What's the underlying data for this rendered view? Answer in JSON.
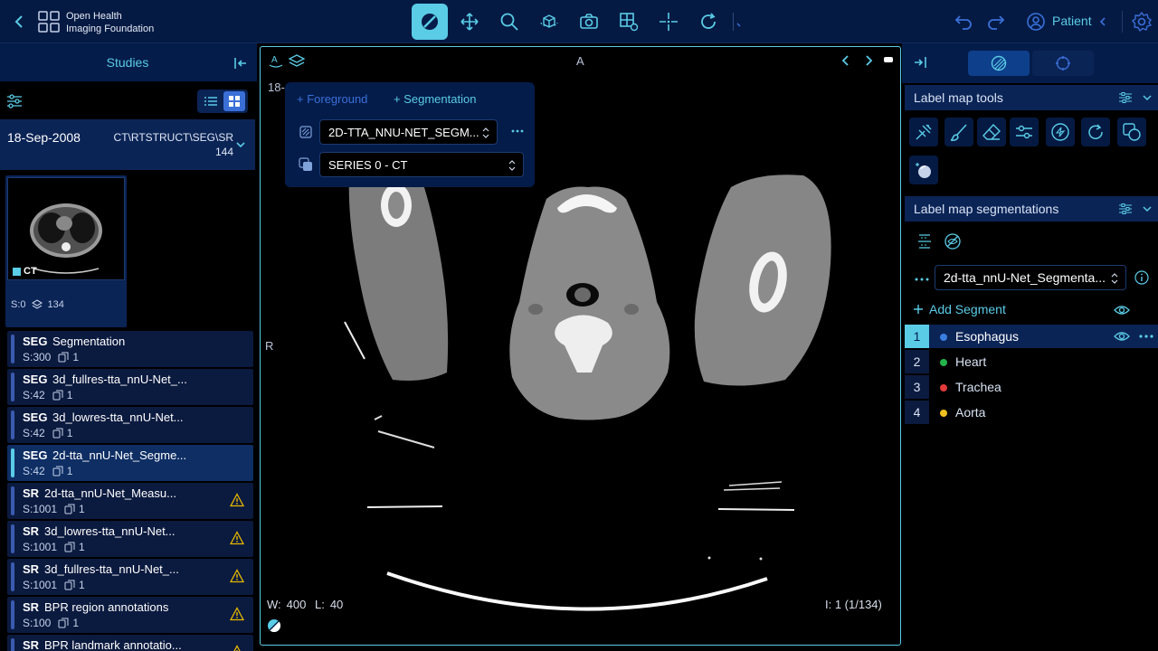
{
  "app": {
    "brand_line1": "Open Health",
    "brand_line2": "Imaging Foundation",
    "patient_label": "Patient"
  },
  "toolbar": {
    "tools": [
      "segmentation-tool-icon",
      "pan-icon",
      "zoom-icon",
      "3d-rotate-icon",
      "capture-icon",
      "layout-icon",
      "crosshairs-icon",
      "reset-icon"
    ]
  },
  "left_panel": {
    "title": "Studies",
    "study": {
      "date": "18-Sep-2008",
      "modalities": "CT\\RTSTRUCT\\SEG\\SR",
      "instances": "144"
    },
    "thumbnail": {
      "modality": "CT",
      "series_number": "S:0",
      "instance_count": "134"
    },
    "series": [
      {
        "modality": "SEG",
        "description": "Segmentation",
        "number": "S:300",
        "count": "1",
        "warning": false,
        "selected": false
      },
      {
        "modality": "SEG",
        "description": "3d_fullres-tta_nnU-Net_...",
        "number": "S:42",
        "count": "1",
        "warning": false,
        "selected": false
      },
      {
        "modality": "SEG",
        "description": "3d_lowres-tta_nnU-Net...",
        "number": "S:42",
        "count": "1",
        "warning": false,
        "selected": false
      },
      {
        "modality": "SEG",
        "description": "2d-tta_nnU-Net_Segme...",
        "number": "S:42",
        "count": "1",
        "warning": false,
        "selected": true
      },
      {
        "modality": "SR",
        "description": "2d-tta_nnU-Net_Measu...",
        "number": "S:1001",
        "count": "1",
        "warning": true,
        "selected": false
      },
      {
        "modality": "SR",
        "description": "3d_lowres-tta_nnU-Net...",
        "number": "S:1001",
        "count": "1",
        "warning": true,
        "selected": false
      },
      {
        "modality": "SR",
        "description": "3d_fullres-tta_nnU-Net_...",
        "number": "S:1001",
        "count": "1",
        "warning": true,
        "selected": false
      },
      {
        "modality": "SR",
        "description": "BPR region annotations",
        "number": "S:100",
        "count": "1",
        "warning": true,
        "selected": false
      },
      {
        "modality": "SR",
        "description": "BPR landmark annotatio...",
        "number": "",
        "count": "",
        "warning": true,
        "selected": false
      }
    ]
  },
  "viewport": {
    "orientation_top": "A",
    "orientation_left": "R",
    "date_fragment": "18-",
    "window_label": "W:",
    "window_value": "400",
    "level_label": "L:",
    "level_value": "40",
    "image_index": "I: 1 (1/134)",
    "overlay": {
      "foreground_label": "+ Foreground",
      "segmentation_label": "+ Segmentation",
      "segmentation_select": "2D-TTA_NNU-NET_SEGM...",
      "series_select": "SERIES 0 - CT"
    }
  },
  "right_panel": {
    "tools_section": "Label map tools",
    "segmentations_section": "Label map segmentations",
    "segmentation_select": "2d-tta_nnU-Net_Segmenta...",
    "add_segment": "Add Segment",
    "segments": [
      {
        "index": "1",
        "label": "Esophagus",
        "color": "#3a7fe0",
        "active": true
      },
      {
        "index": "2",
        "label": "Heart",
        "color": "#22b34a",
        "active": false
      },
      {
        "index": "3",
        "label": "Trachea",
        "color": "#e03a3a",
        "active": false
      },
      {
        "index": "4",
        "label": "Aorta",
        "color": "#f0c020",
        "active": false
      }
    ]
  },
  "colors": {
    "accent": "#5acce6",
    "header_bg": "#051a43",
    "panel_bg": "#0b2456",
    "warning": "#e6b800"
  }
}
